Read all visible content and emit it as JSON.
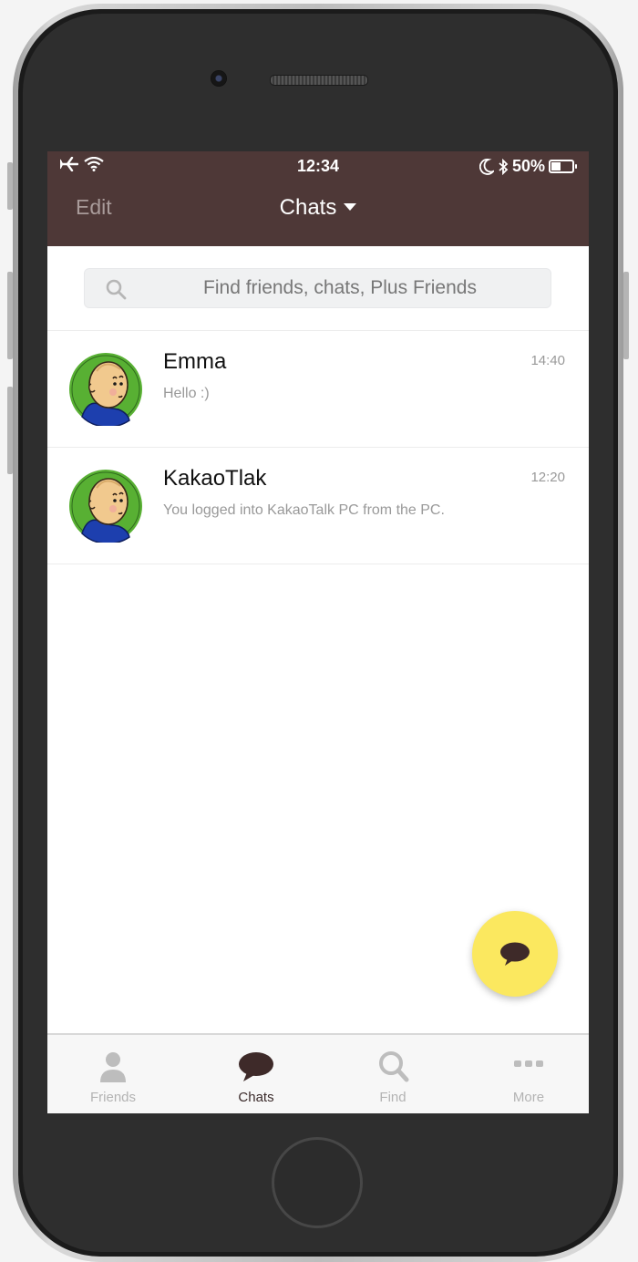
{
  "status_bar": {
    "time": "12:34",
    "battery": "50%",
    "icons": [
      "airplane-icon",
      "wifi-icon",
      "moon-icon",
      "bluetooth-icon",
      "battery-icon"
    ]
  },
  "header": {
    "edit_label": "Edit",
    "title": "Chats"
  },
  "search": {
    "placeholder": "Find friends, chats, Plus Friends"
  },
  "chats": [
    {
      "name": "Emma",
      "time": "14:40",
      "message": "Hello :)"
    },
    {
      "name": "KakaoTlak",
      "time": "12:20",
      "message": "You logged into KakaoTalk PC from the PC."
    }
  ],
  "tabs": [
    {
      "label": "Friends",
      "icon": "person-icon",
      "active": false
    },
    {
      "label": "Chats",
      "icon": "speech-bubble-icon",
      "active": true
    },
    {
      "label": "Find",
      "icon": "magnifier-icon",
      "active": false
    },
    {
      "label": "More",
      "icon": "ellipsis-icon",
      "active": false
    }
  ],
  "colors": {
    "header_bg": "#4e3837",
    "fab_bg": "#fbe85f",
    "avatar_bg": "#58b033"
  }
}
